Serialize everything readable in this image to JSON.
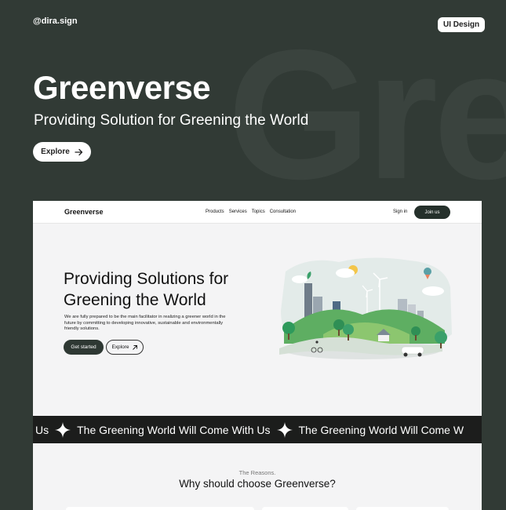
{
  "header": {
    "handle": "@dira.sign",
    "tag": "UI Design",
    "background_word": "Gre",
    "title": "Greenverse",
    "subtitle": "Providing Solution for Greening the World",
    "explore_label": "Explore"
  },
  "mockup": {
    "nav": {
      "brand": "Greenverse",
      "links": [
        "Products",
        "Services",
        "Topics",
        "Consultation"
      ],
      "signin": "Sign in",
      "join": "Join us"
    },
    "hero": {
      "heading_line1": "Providing Solutions for",
      "heading_line2": "Greening the World",
      "paragraph": "We are fully prepared to be the main facilitator in realizing a greener world in the future by committing to developing innovative, sustainable and environmentally friendly solutions.",
      "primary_button": "Get started",
      "secondary_button": "Explore"
    },
    "marquee": {
      "lead": "Us",
      "phrase1": "The Greening World Will Come With Us",
      "phrase2": "The Greening World Will Come W"
    },
    "reasons": {
      "kicker": "The Reasons.",
      "title": "Why should choose Greenverse?"
    }
  },
  "colors": {
    "background": "#313a35",
    "card_bg": "#f4f4f5",
    "dark_button": "#2e3833",
    "marquee_bg": "#1c1d1c",
    "green_accent": "#3aa06a"
  },
  "icons": [
    "arrow-right-icon",
    "arrow-up-right-icon",
    "sparkle-star-icon"
  ]
}
